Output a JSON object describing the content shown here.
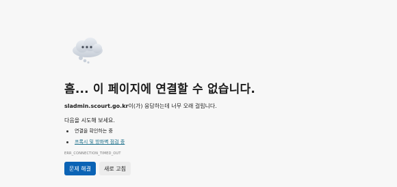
{
  "error_page": {
    "title": "흠... 이 페이지에 연결할 수 없습니다.",
    "host": "sladmin.scourt.go.kr",
    "description_suffix": "이(가) 응답하는데 너무 오래 걸립니다.",
    "try_heading": "다음을 시도해 보세요.",
    "suggestions": [
      {
        "label": "연결을 확인하는 중",
        "link": false
      },
      {
        "label": "프록시 및 방화벽 점검 중",
        "link": true
      }
    ],
    "error_code": "ERR_CONNECTION_TIMED_OUT",
    "buttons": {
      "troubleshoot_label": "문제 해결",
      "refresh_label": "새로 고침"
    }
  },
  "colors": {
    "background": "#f7f7f7",
    "primary_button": "#0b63b5",
    "link": "#1a6e8a"
  },
  "icons": {
    "illustration": "cloud-icon"
  }
}
